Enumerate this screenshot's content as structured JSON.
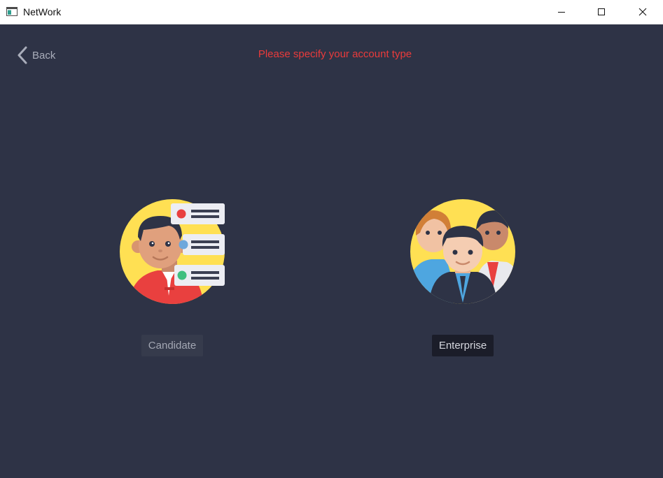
{
  "window": {
    "title": "NetWork",
    "icon": "app-window-icon",
    "controls": [
      "minimize-icon",
      "maximize-icon",
      "close-icon"
    ]
  },
  "header": {
    "back_label": "Back",
    "prompt": "Please specify your account type"
  },
  "options": [
    {
      "label": "Candidate",
      "illustration": "candidate-person-with-cards"
    },
    {
      "label": "Enterprise",
      "illustration": "group-of-people"
    }
  ],
  "colors": {
    "background": "#2e3346",
    "prompt": "#ea3b3b",
    "illustration_circle": "#ffe053",
    "candidate_button": "#363b4c",
    "enterprise_button": "#1b1d29"
  }
}
